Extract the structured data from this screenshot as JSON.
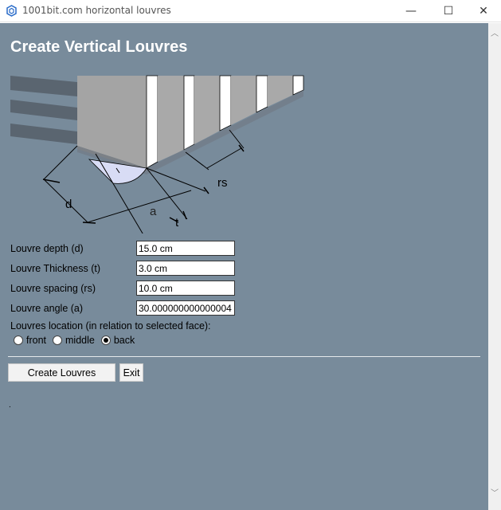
{
  "window": {
    "title": "1001bit.com horizontal louvres",
    "minimize_glyph": "—",
    "maximize_glyph": "☐",
    "close_glyph": "✕",
    "icon": "sketchup-app-icon"
  },
  "page": {
    "heading": "Create Vertical Louvres",
    "diagram_labels": {
      "depth": "d",
      "angle": "a",
      "thickness": "t",
      "spacing": "rs"
    }
  },
  "form": {
    "depth_label": "Louvre depth (d)",
    "depth_value": "15.0 cm",
    "thickness_label": "Louvre Thickness (t)",
    "thickness_value": "3.0 cm",
    "spacing_label": "Louvre spacing (rs)",
    "spacing_value": "10.0 cm",
    "angle_label": "Louvre angle (a)",
    "angle_value": "30.000000000000004",
    "location_label": "Louvres location (in relation to selected face):",
    "location_options": [
      "front",
      "middle",
      "back"
    ],
    "location_selected": "back"
  },
  "buttons": {
    "create_label": "Create Louvres",
    "exit_label": "Exit"
  },
  "footer": {
    "status_text": "."
  },
  "colors": {
    "client_bg": "#788b9b",
    "heading": "#ffffff"
  }
}
